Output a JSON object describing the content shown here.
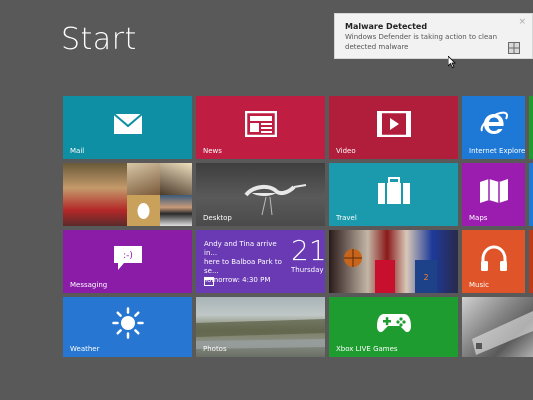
{
  "start": {
    "title": "Start"
  },
  "toast": {
    "title": "Malware Detected",
    "message": "Windows Defender is taking action to clean detected malware",
    "close_glyph": "×"
  },
  "tiles": {
    "mail": {
      "label": "Mail",
      "color": "#0f8fa3"
    },
    "news": {
      "label": "News",
      "color": "#bf1e42"
    },
    "video": {
      "label": "Video",
      "color": "#b01e3b"
    },
    "ie": {
      "label": "Internet Explorer",
      "color": "#1d78d6"
    },
    "people": {
      "label": ""
    },
    "desktop": {
      "label": "Desktop"
    },
    "travel": {
      "label": "Travel",
      "color": "#1b9aae"
    },
    "maps": {
      "label": "Maps",
      "color": "#9b1db0"
    },
    "messaging": {
      "label": "Messaging",
      "color": "#8a1ca8"
    },
    "calendar": {
      "event": "Andy and Tina arrive in... here to Balboa Park to se... Tomorrow: 4:30 PM Balboa Park",
      "line1": "Andy and Tina arrive in...",
      "line2": "here to Balboa Park to se...",
      "line3": "Tomorrow: 4:30 PM",
      "line4": "Balboa Park",
      "date_number": "21",
      "day_name": "Thursday",
      "color": "#6a3ab5"
    },
    "sports": {
      "label": ""
    },
    "music": {
      "label": "Music",
      "color": "#e0542a"
    },
    "weather": {
      "label": "Weather",
      "color": "#2776d1"
    },
    "photos": {
      "label": "Photos"
    },
    "xbox": {
      "label": "Xbox LIVE Games",
      "color": "#1e9c30"
    },
    "finance": {
      "label": ""
    }
  }
}
